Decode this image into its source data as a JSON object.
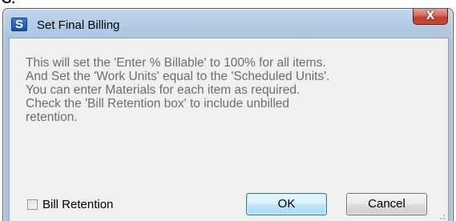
{
  "window": {
    "title": "Set Final Billing",
    "app_icon_letter": "S",
    "close_glyph": "X"
  },
  "corner_fragment": "G.",
  "message": {
    "lines": [
      "This will set the 'Enter % Billable' to 100% for all items.",
      "And Set the 'Work Units' equal to the 'Scheduled Units'.",
      "You can enter Materials for each item as required.",
      "Check the 'Bill Retention box' to include unbilled",
      "retention."
    ]
  },
  "bill_retention": {
    "label": "Bill Retention",
    "checked": false
  },
  "buttons": {
    "ok_label": "OK",
    "cancel_label": "Cancel"
  },
  "colors": {
    "title_bar": "#b3cbe5",
    "close_button": "#c44b38",
    "message_text": "#6d6d6d",
    "dialog_background": "#f0f0f0",
    "ok_border": "#3c7fb1"
  },
  "icons": {
    "app": "app-s-icon",
    "close": "close-icon",
    "grip": "resize-grip-icon"
  }
}
